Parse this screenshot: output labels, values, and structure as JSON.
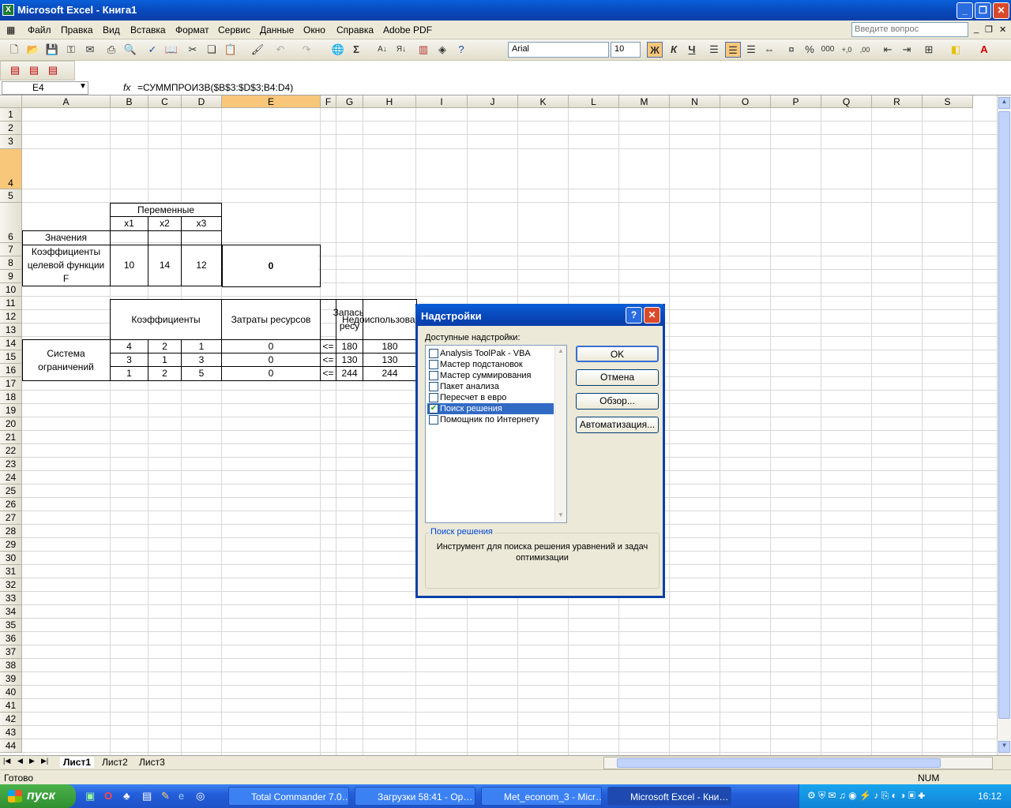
{
  "window": {
    "title": "Microsoft Excel - Книга1"
  },
  "menu": {
    "items": [
      "Файл",
      "Правка",
      "Вид",
      "Вставка",
      "Формат",
      "Сервис",
      "Данные",
      "Окно",
      "Справка",
      "Adobe PDF"
    ],
    "ask_placeholder": "Введите вопрос"
  },
  "toolbar": {
    "font": "Arial",
    "size": "10",
    "bold": "Ж",
    "italic": "К",
    "underline": "Ч"
  },
  "formula_bar": {
    "name": "E4",
    "fx": "fx",
    "formula": "=СУММПРОИЗВ($B$3:$D$3;B4:D4)"
  },
  "columns": [
    "A",
    "B",
    "C",
    "D",
    "E",
    "F",
    "G",
    "H",
    "I",
    "J",
    "K",
    "L",
    "M",
    "N",
    "O",
    "P",
    "Q",
    "R",
    "S"
  ],
  "rows": [
    "1",
    "2",
    "3",
    "4",
    "5",
    "6",
    "7",
    "8",
    "9",
    "10",
    "11",
    "12",
    "13",
    "14",
    "15",
    "16",
    "17",
    "18",
    "19",
    "20",
    "21",
    "22",
    "23",
    "24",
    "25",
    "26",
    "27",
    "28",
    "29",
    "30",
    "31",
    "32",
    "33",
    "34",
    "35",
    "36",
    "37",
    "38",
    "39",
    "40",
    "41",
    "42",
    "43",
    "44"
  ],
  "cells": {
    "b1": "Переменные",
    "b2": "x1",
    "c2": "x2",
    "d2": "x3",
    "a3": "Значения",
    "a4": "Коэффициенты целевой функции F",
    "b4": "10",
    "c4": "14",
    "d4": "12",
    "e4": "0",
    "b6": "Коэффициенты",
    "e6": "Затраты ресурсов",
    "g6": "Запасы ресу",
    "h6": "Недоиспользованные",
    "a7": "Система ограничений",
    "b7": "4",
    "c7": "2",
    "d7": "1",
    "e7": "0",
    "f7": "<=",
    "g7": "180",
    "h7": "180",
    "b8": "3",
    "c8": "1",
    "d8": "3",
    "e8": "0",
    "f8": "<=",
    "g8": "130",
    "h8": "130",
    "b9": "1",
    "c9": "2",
    "d9": "5",
    "e9": "0",
    "f9": "<=",
    "g9": "244",
    "h9": "244"
  },
  "sheets": {
    "tabs": [
      "Лист1",
      "Лист2",
      "Лист3"
    ]
  },
  "status": {
    "left": "Готово",
    "num": "NUM"
  },
  "dialog": {
    "title": "Надстройки",
    "available_label": "Доступные надстройки:",
    "addins": [
      {
        "label": "Analysis ToolPak - VBA",
        "checked": false
      },
      {
        "label": "Мастер подстановок",
        "checked": false
      },
      {
        "label": "Мастер суммирования",
        "checked": false
      },
      {
        "label": "Пакет анализа",
        "checked": false
      },
      {
        "label": "Пересчет в евро",
        "checked": false
      },
      {
        "label": "Поиск решения",
        "checked": true
      },
      {
        "label": "Помощник по Интернету",
        "checked": false
      }
    ],
    "ok": "OK",
    "cancel": "Отмена",
    "browse": "Обзор...",
    "automation": "Автоматизация...",
    "desc_title": "Поиск решения",
    "desc_text": "Инструмент для поиска решения уравнений и задач оптимизации"
  },
  "taskbar": {
    "start": "пуск",
    "tasks": [
      "Total Commander 7.0…",
      "Загрузки 58:41 - Op…",
      "Met_econom_3 - Micr…",
      "Microsoft Excel - Кни…"
    ],
    "clock": "16:12"
  }
}
